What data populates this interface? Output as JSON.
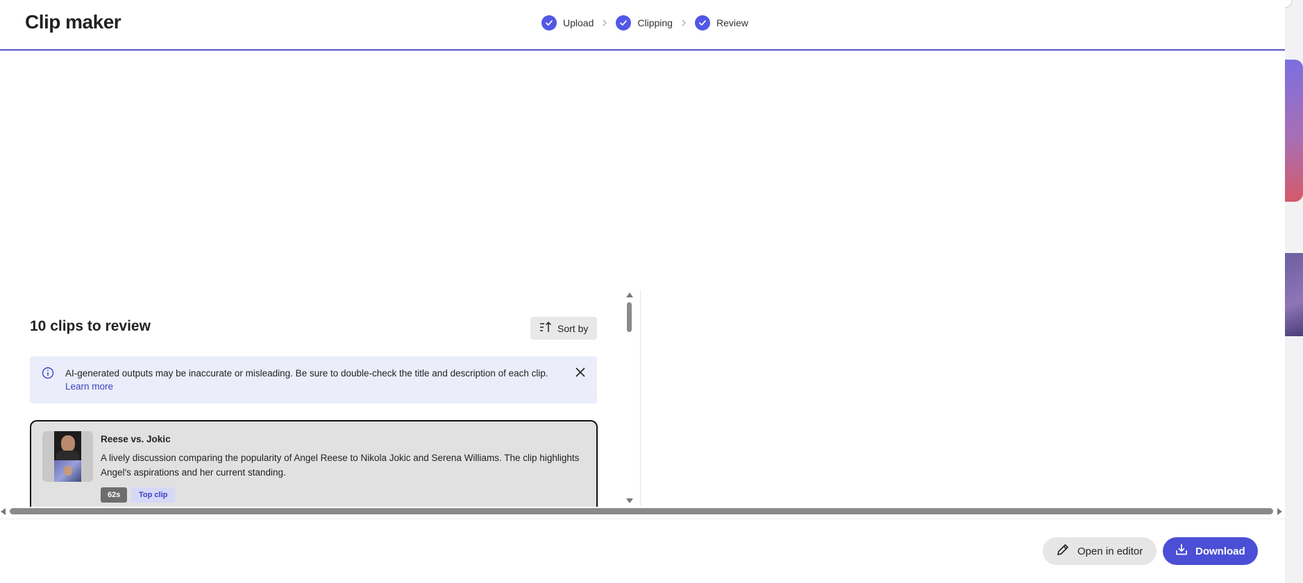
{
  "app": {
    "title": "Clip maker"
  },
  "stepper": {
    "steps": [
      {
        "label": "Upload",
        "status": "complete"
      },
      {
        "label": "Clipping",
        "status": "complete"
      },
      {
        "label": "Review",
        "status": "complete"
      }
    ]
  },
  "review": {
    "title": "10 clips to review",
    "sort_label": "Sort by"
  },
  "notice": {
    "text": "AI-generated outputs may be inaccurate or misleading. Be sure to double-check the title and description of each clip.",
    "link": "Learn more"
  },
  "clips": [
    {
      "title": "Reese vs. Jokic",
      "description": "A lively discussion comparing the popularity of Angel Reese to Nikola Jokic and Serena Williams. The clip highlights Angel's aspirations and her current standing.",
      "duration": "62s",
      "tag": "Top clip"
    }
  ],
  "footer": {
    "open_editor_label": "Open in editor",
    "download_label": "Download"
  },
  "colors": {
    "accent": "#4b4fd6",
    "step_check": "#5258e6",
    "notice_bg": "#ecedfb",
    "link": "#3b40c0"
  }
}
